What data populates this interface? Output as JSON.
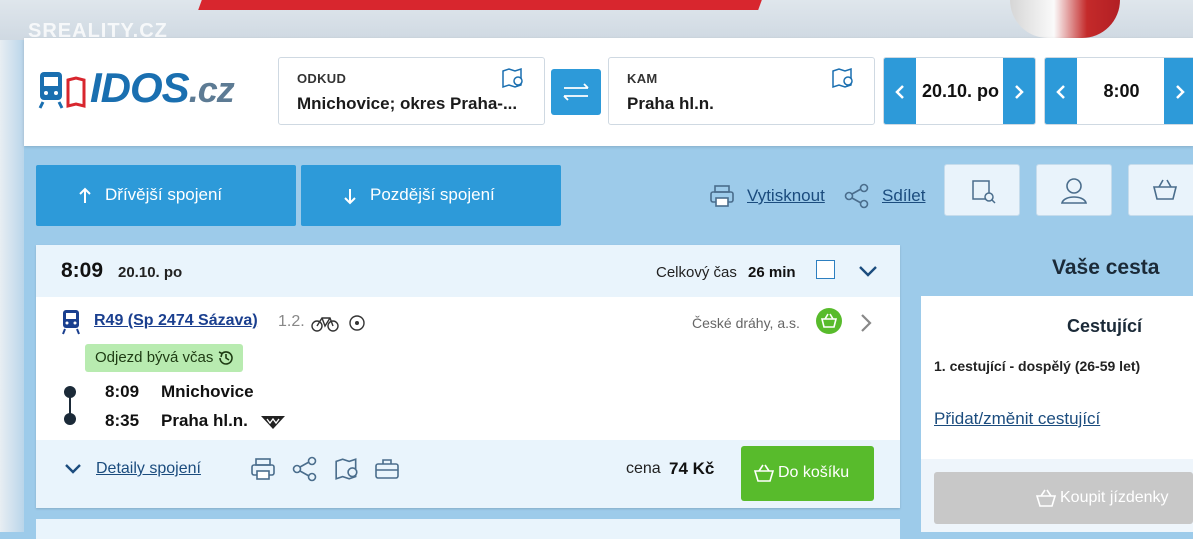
{
  "watermark": "SREALITY.CZ",
  "logo": {
    "main": "IDOS",
    "suffix": ".cz"
  },
  "search": {
    "from_label": "ODKUD",
    "from_value": "Mnichovice; okres Praha-...",
    "to_label": "KAM",
    "to_value": "Praha hl.n.",
    "date": "20.10. po",
    "time": "8:00"
  },
  "toolbar": {
    "earlier": "Dřívější spojení",
    "later": "Pozdější spojení",
    "print": "Vytisknout",
    "share": "Sdílet"
  },
  "connection": {
    "dep_time": "8:09",
    "date": "20.10. po",
    "total_label": "Celkový čas",
    "total_value": "26 min",
    "train": "R49 (Sp 2474 Sázava)",
    "train_class": "1.2.",
    "operator": "České dráhy, a.s.",
    "badge": "Odjezd bývá včas",
    "stops": [
      {
        "time": "8:09",
        "name": "Mnichovice"
      },
      {
        "time": "8:35",
        "name": "Praha hl.n."
      }
    ],
    "details_link": "Detaily spojení",
    "price_label": "cena",
    "price_value": "74 Kč",
    "cart_button": "Do košíku"
  },
  "sidebar": {
    "title": "Vaše cesta",
    "section_title": "Cestující",
    "passenger": "1. cestující - dospělý (26-59 let)",
    "change_link": "Přidat/změnit cestující",
    "buy_button": "Koupit jízdenky"
  },
  "colors": {
    "primary": "#2d9ad9",
    "green": "#58bb2c",
    "link": "#1b4c7e"
  }
}
